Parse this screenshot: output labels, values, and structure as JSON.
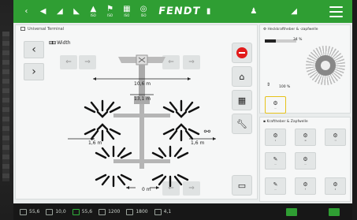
{
  "topbar": {
    "logo": "FENDT",
    "icons": [
      {
        "name": "tractor-back-icon",
        "glyph": "‹",
        "label": ""
      },
      {
        "name": "volume-icon",
        "glyph": "◀",
        "label": ""
      },
      {
        "name": "signal-icon",
        "glyph": "◢",
        "label": ""
      },
      {
        "name": "tool-icon",
        "glyph": "◣",
        "label": ""
      },
      {
        "name": "weight-icon",
        "glyph": "▲",
        "label": ""
      },
      {
        "name": "implement-icon",
        "glyph": "⚑",
        "label": ""
      },
      {
        "name": "camera-icon",
        "glyph": "▦",
        "label": ""
      },
      {
        "name": "settings-icon",
        "glyph": "◎",
        "label": ""
      }
    ]
  },
  "terminal": {
    "title": "Universal Terminal",
    "width_label": "Width",
    "dims": {
      "total_width": "10,6 m",
      "inner_width": "13,1 m",
      "left_offset": "1,6 m",
      "right_offset": "1,6 m",
      "bottom_offset": "0 m"
    }
  },
  "right_panel": {
    "hitch_title": "Heckkraftheber & -zapfwelle",
    "hitch_value": "34 %",
    "depth_value": "100 %",
    "pto_title": "Kraftheber & Zapfwelle"
  },
  "bottombar": {
    "items": [
      {
        "name": "speed-readout",
        "value": "55,6"
      },
      {
        "name": "pto-readout",
        "value": "10,0"
      },
      {
        "name": "ground-speed-readout",
        "value": "55,6"
      },
      {
        "name": "rear-pto-readout",
        "value": "1200"
      },
      {
        "name": "front-pto-readout",
        "value": "1800"
      },
      {
        "name": "hitch-readout",
        "value": "4,1"
      }
    ]
  }
}
